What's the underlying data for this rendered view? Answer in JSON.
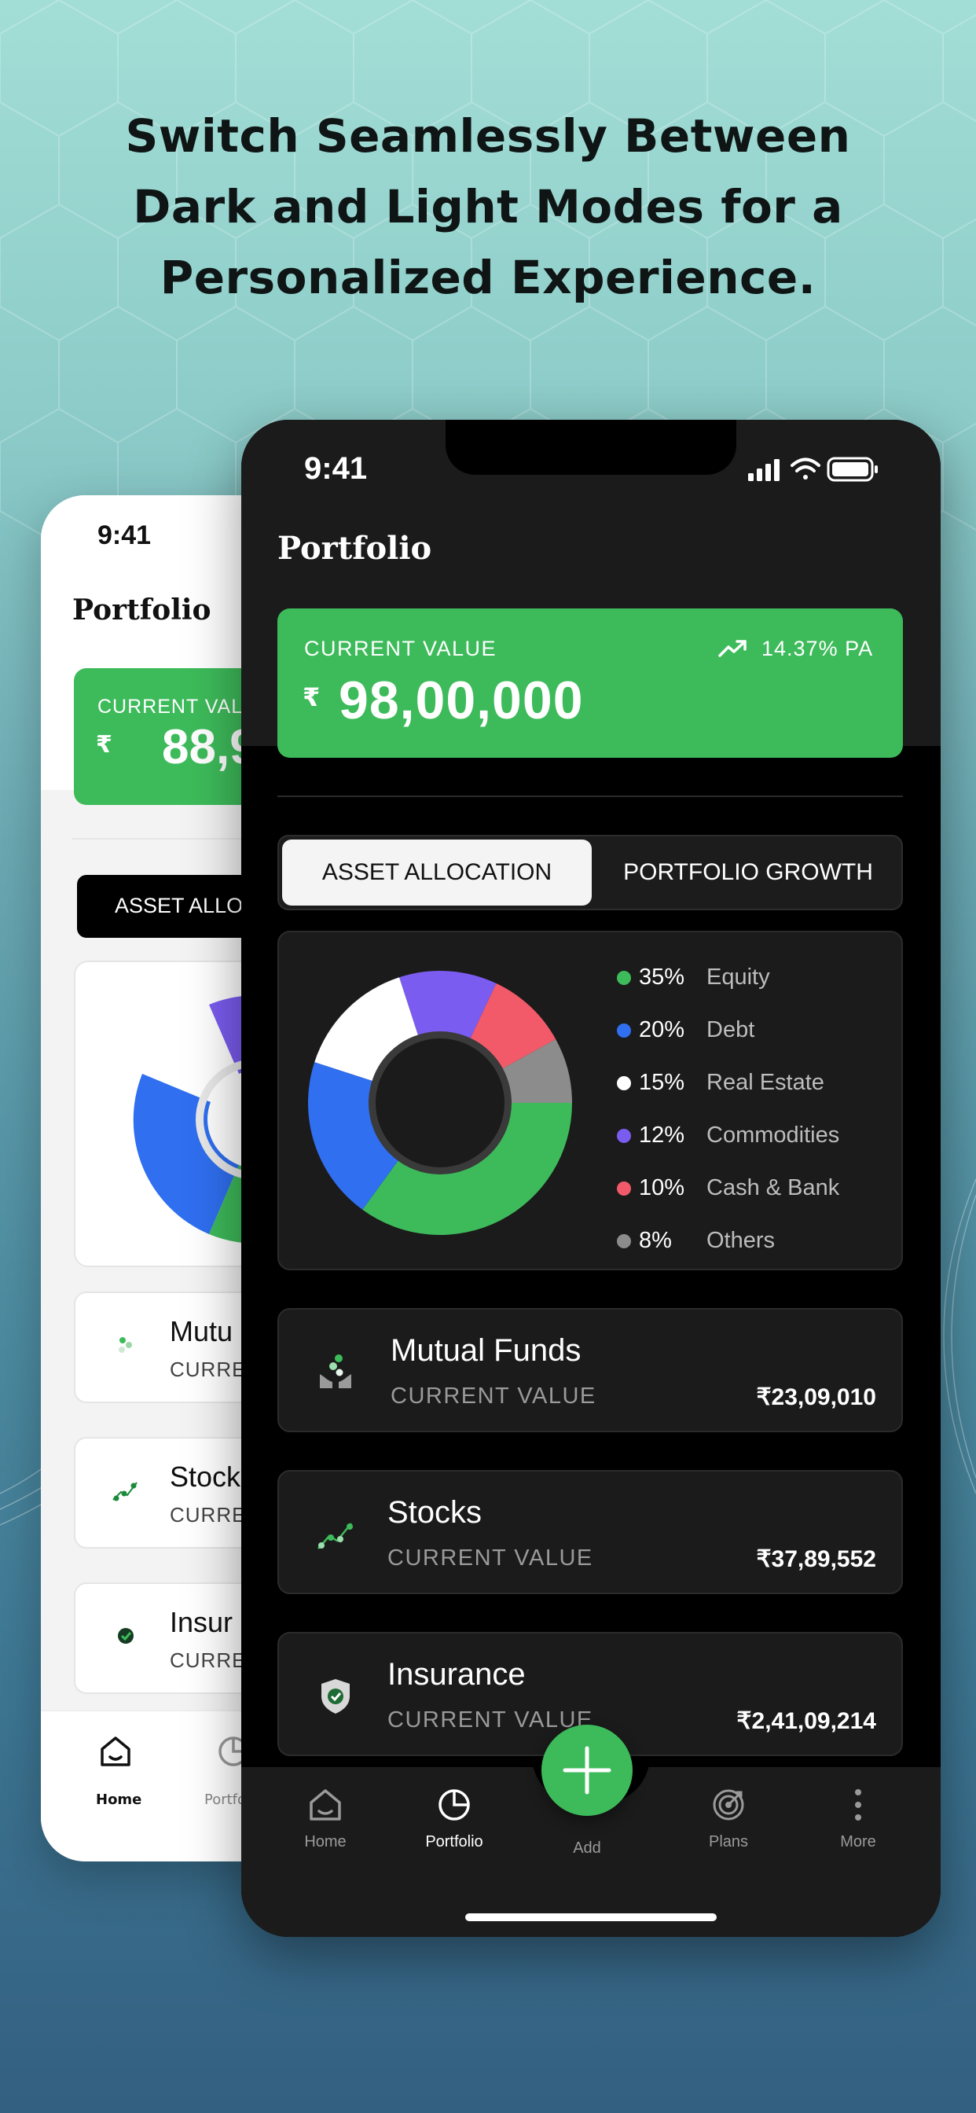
{
  "headline": {
    "line1": "Switch Seamlessly Between",
    "line2": "Dark and Light Modes for a",
    "line3": "Personalized Experience."
  },
  "light_phone": {
    "time": "9:41",
    "title": "Portfolio",
    "card": {
      "label": "CURRENT VAL",
      "currency": "₹",
      "value": "88,9"
    },
    "tab_active": "ASSET ALLO",
    "list": [
      {
        "name": "Mutu",
        "sub": "CURRE"
      },
      {
        "name": "Stock",
        "sub": "CURRE"
      },
      {
        "name": "Insur",
        "sub": "CURRE"
      }
    ],
    "nav": {
      "home": "Home",
      "portfolio": "Portfo"
    }
  },
  "dark_phone": {
    "time": "9:41",
    "title": "Portfolio",
    "card": {
      "label": "CURRENT VALUE",
      "currency": "₹",
      "value": "98,00,000",
      "return": "14.37% PA"
    },
    "tabs": {
      "active": "ASSET ALLOCATION",
      "inactive": "PORTFOLIO GROWTH"
    },
    "allocation": [
      {
        "pct": "35%",
        "name": "Equity",
        "color": "#3dbb5a"
      },
      {
        "pct": "20%",
        "name": "Debt",
        "color": "#2f6ff0"
      },
      {
        "pct": "15%",
        "name": "Real Estate",
        "color": "#ffffff"
      },
      {
        "pct": "12%",
        "name": "Commodities",
        "color": "#7b5cf0"
      },
      {
        "pct": "10%",
        "name": "Cash & Bank",
        "color": "#f25a6a"
      },
      {
        "pct": "8%",
        "name": "Others",
        "color": "#8c8c8c"
      }
    ],
    "holdings": [
      {
        "name": "Mutual Funds",
        "sub": "CURRENT VALUE",
        "amount": "₹23,09,010"
      },
      {
        "name": "Stocks",
        "sub": "CURRENT VALUE",
        "amount": "₹37,89,552"
      },
      {
        "name": "Insurance",
        "sub": "CURRENT VALUE",
        "amount": "₹2,41,09,214"
      }
    ],
    "nav": {
      "home": "Home",
      "portfolio": "Portfolio",
      "add": "Add",
      "plans": "Plans",
      "more": "More"
    }
  }
}
